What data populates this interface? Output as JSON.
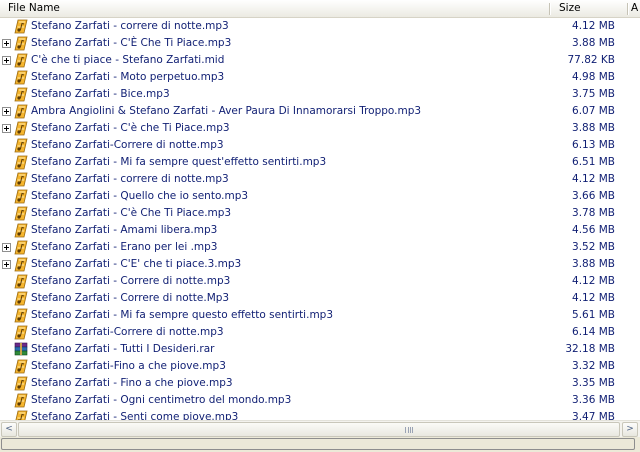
{
  "header": {
    "columns": [
      {
        "label": "File Name"
      },
      {
        "label": "Size"
      },
      {
        "label": "A"
      }
    ]
  },
  "files": [
    {
      "name": "Stefano Zarfati - correre di notte.mp3",
      "size": "4.12 MB",
      "expandable": false,
      "icon": "audio-file-icon"
    },
    {
      "name": "Stefano Zarfati - C'È Che Ti Piace.mp3",
      "size": "3.88 MB",
      "expandable": true,
      "icon": "audio-file-icon"
    },
    {
      "name": "C'è che ti piace - Stefano Zarfati.mid",
      "size": "77.82 KB",
      "expandable": true,
      "icon": "audio-file-icon"
    },
    {
      "name": "Stefano Zarfati - Moto perpetuo.mp3",
      "size": "4.98 MB",
      "expandable": false,
      "icon": "audio-file-icon"
    },
    {
      "name": "Stefano Zarfati - Bice.mp3",
      "size": "3.75 MB",
      "expandable": false,
      "icon": "audio-file-icon"
    },
    {
      "name": "Ambra Angiolini & Stefano Zarfati - Aver Paura Di Innamorarsi Troppo.mp3",
      "size": "6.07 MB",
      "expandable": true,
      "icon": "audio-file-icon"
    },
    {
      "name": "Stefano Zarfati - C'è che Ti Piace.mp3",
      "size": "3.88 MB",
      "expandable": true,
      "icon": "audio-file-icon"
    },
    {
      "name": "Stefano Zarfati-Correre di notte.mp3",
      "size": "6.13 MB",
      "expandable": false,
      "icon": "audio-file-icon"
    },
    {
      "name": "Stefano Zarfati - Mi fa sempre quest'effetto sentirti.mp3",
      "size": "6.51 MB",
      "expandable": false,
      "icon": "audio-file-icon"
    },
    {
      "name": "Stefano Zarfati - correre di notte.mp3",
      "size": "4.12 MB",
      "expandable": false,
      "icon": "audio-file-icon"
    },
    {
      "name": "Stefano Zarfati - Quello che io sento.mp3",
      "size": "3.66 MB",
      "expandable": false,
      "icon": "audio-file-icon"
    },
    {
      "name": "Stefano Zarfati - C'è Che Ti Piace.mp3",
      "size": "3.78 MB",
      "expandable": false,
      "icon": "audio-file-icon"
    },
    {
      "name": "Stefano Zarfati - Amami libera.mp3",
      "size": "4.56 MB",
      "expandable": false,
      "icon": "audio-file-icon"
    },
    {
      "name": "Stefano Zarfati - Erano per lei .mp3",
      "size": "3.52 MB",
      "expandable": true,
      "icon": "audio-file-icon"
    },
    {
      "name": "Stefano Zarfati - C'E' che ti piace.3.mp3",
      "size": "3.88 MB",
      "expandable": true,
      "icon": "audio-file-icon"
    },
    {
      "name": "Stefano Zarfati - Correre di notte.mp3",
      "size": "4.12 MB",
      "expandable": false,
      "icon": "audio-file-icon"
    },
    {
      "name": "Stefano Zarfati - Correre di notte.Mp3",
      "size": "4.12 MB",
      "expandable": false,
      "icon": "audio-file-icon"
    },
    {
      "name": "Stefano Zarfati - Mi fa sempre questo effetto sentirti.mp3",
      "size": "5.61 MB",
      "expandable": false,
      "icon": "audio-file-icon"
    },
    {
      "name": "Stefano Zarfati-Correre di notte.mp3",
      "size": "6.14 MB",
      "expandable": false,
      "icon": "audio-file-icon"
    },
    {
      "name": "Stefano Zarfati - Tutti I Desideri.rar",
      "size": "32.18 MB",
      "expandable": false,
      "icon": "archive-file-icon"
    },
    {
      "name": "Stefano Zarfati-Fino a che piove.mp3",
      "size": "3.32 MB",
      "expandable": false,
      "icon": "audio-file-icon"
    },
    {
      "name": "Stefano Zarfati - Fino a che piove.mp3",
      "size": "3.35 MB",
      "expandable": false,
      "icon": "audio-file-icon"
    },
    {
      "name": "Stefano Zarfati - Ogni centimetro del mondo.mp3",
      "size": "3.36 MB",
      "expandable": false,
      "icon": "audio-file-icon"
    },
    {
      "name": "Stefano Zarfati - Senti come piove.mp3",
      "size": "3.47 MB",
      "expandable": false,
      "icon": "audio-file-icon"
    }
  ],
  "scrollbar": {
    "left_arrow": "<",
    "right_arrow": ">",
    "position": 0.0
  },
  "colors": {
    "text": "#0f1e73",
    "header_bg": "#ebeae2",
    "audio_icon": "#f3b12c",
    "statusbar_bg": "#ece9d8"
  }
}
